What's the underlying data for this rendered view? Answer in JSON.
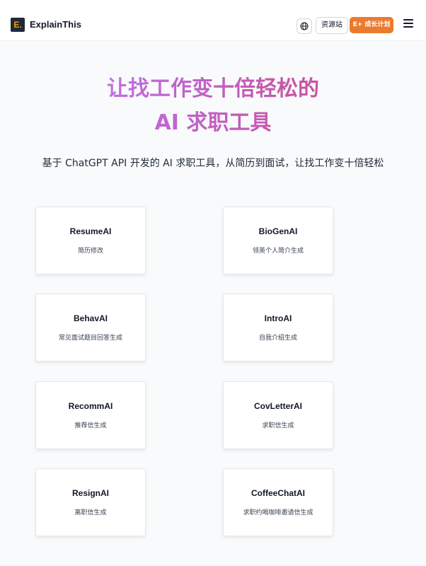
{
  "header": {
    "logo_letter": "E.",
    "brand": "ExplainThis",
    "globe_icon": "globe-icon",
    "resources_label": "资源站",
    "growth_label": "E+ 成长计划",
    "accent_color": "#ec7a2e",
    "menu_icon": "hamburger-menu-icon"
  },
  "hero": {
    "title_line1": "让找工作变十倍轻松的",
    "title_line2": "AI 求职工具",
    "subtitle": "基于 ChatGPT API 开发的 AI 求职工具，从简历到面试，让找工作变十倍轻松"
  },
  "tools": [
    {
      "name": "ResumeAI",
      "desc": "简历修改"
    },
    {
      "name": "BioGenAI",
      "desc": "领英个人简介生成"
    },
    {
      "name": "BehavAI",
      "desc": "常见面试题目回答生成"
    },
    {
      "name": "IntroAI",
      "desc": "自我介绍生成"
    },
    {
      "name": "RecommAI",
      "desc": "推荐信生成"
    },
    {
      "name": "CovLetterAI",
      "desc": "求职信生成"
    },
    {
      "name": "ResignAI",
      "desc": "离职信生成"
    },
    {
      "name": "CoffeeChatAI",
      "desc": "求职约喝咖啡邀请信生成"
    }
  ]
}
